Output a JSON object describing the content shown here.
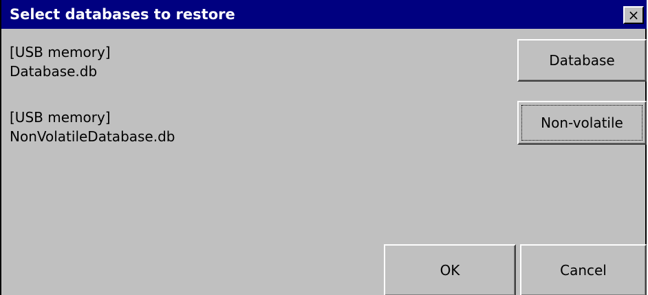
{
  "dialog": {
    "title": "Select databases to restore",
    "close_glyph": "×",
    "colors": {
      "titlebar": "#000080",
      "title_text": "#ffffff",
      "face": "#c0c0c0"
    }
  },
  "items": [
    {
      "location": "[USB memory]",
      "file": "Database.db",
      "button_label": "Database"
    },
    {
      "location": "[USB memory]",
      "file": "NonVolatileDatabase.db",
      "button_label": "Non-volatile"
    }
  ],
  "footer": {
    "ok_label": "OK",
    "cancel_label": "Cancel"
  }
}
